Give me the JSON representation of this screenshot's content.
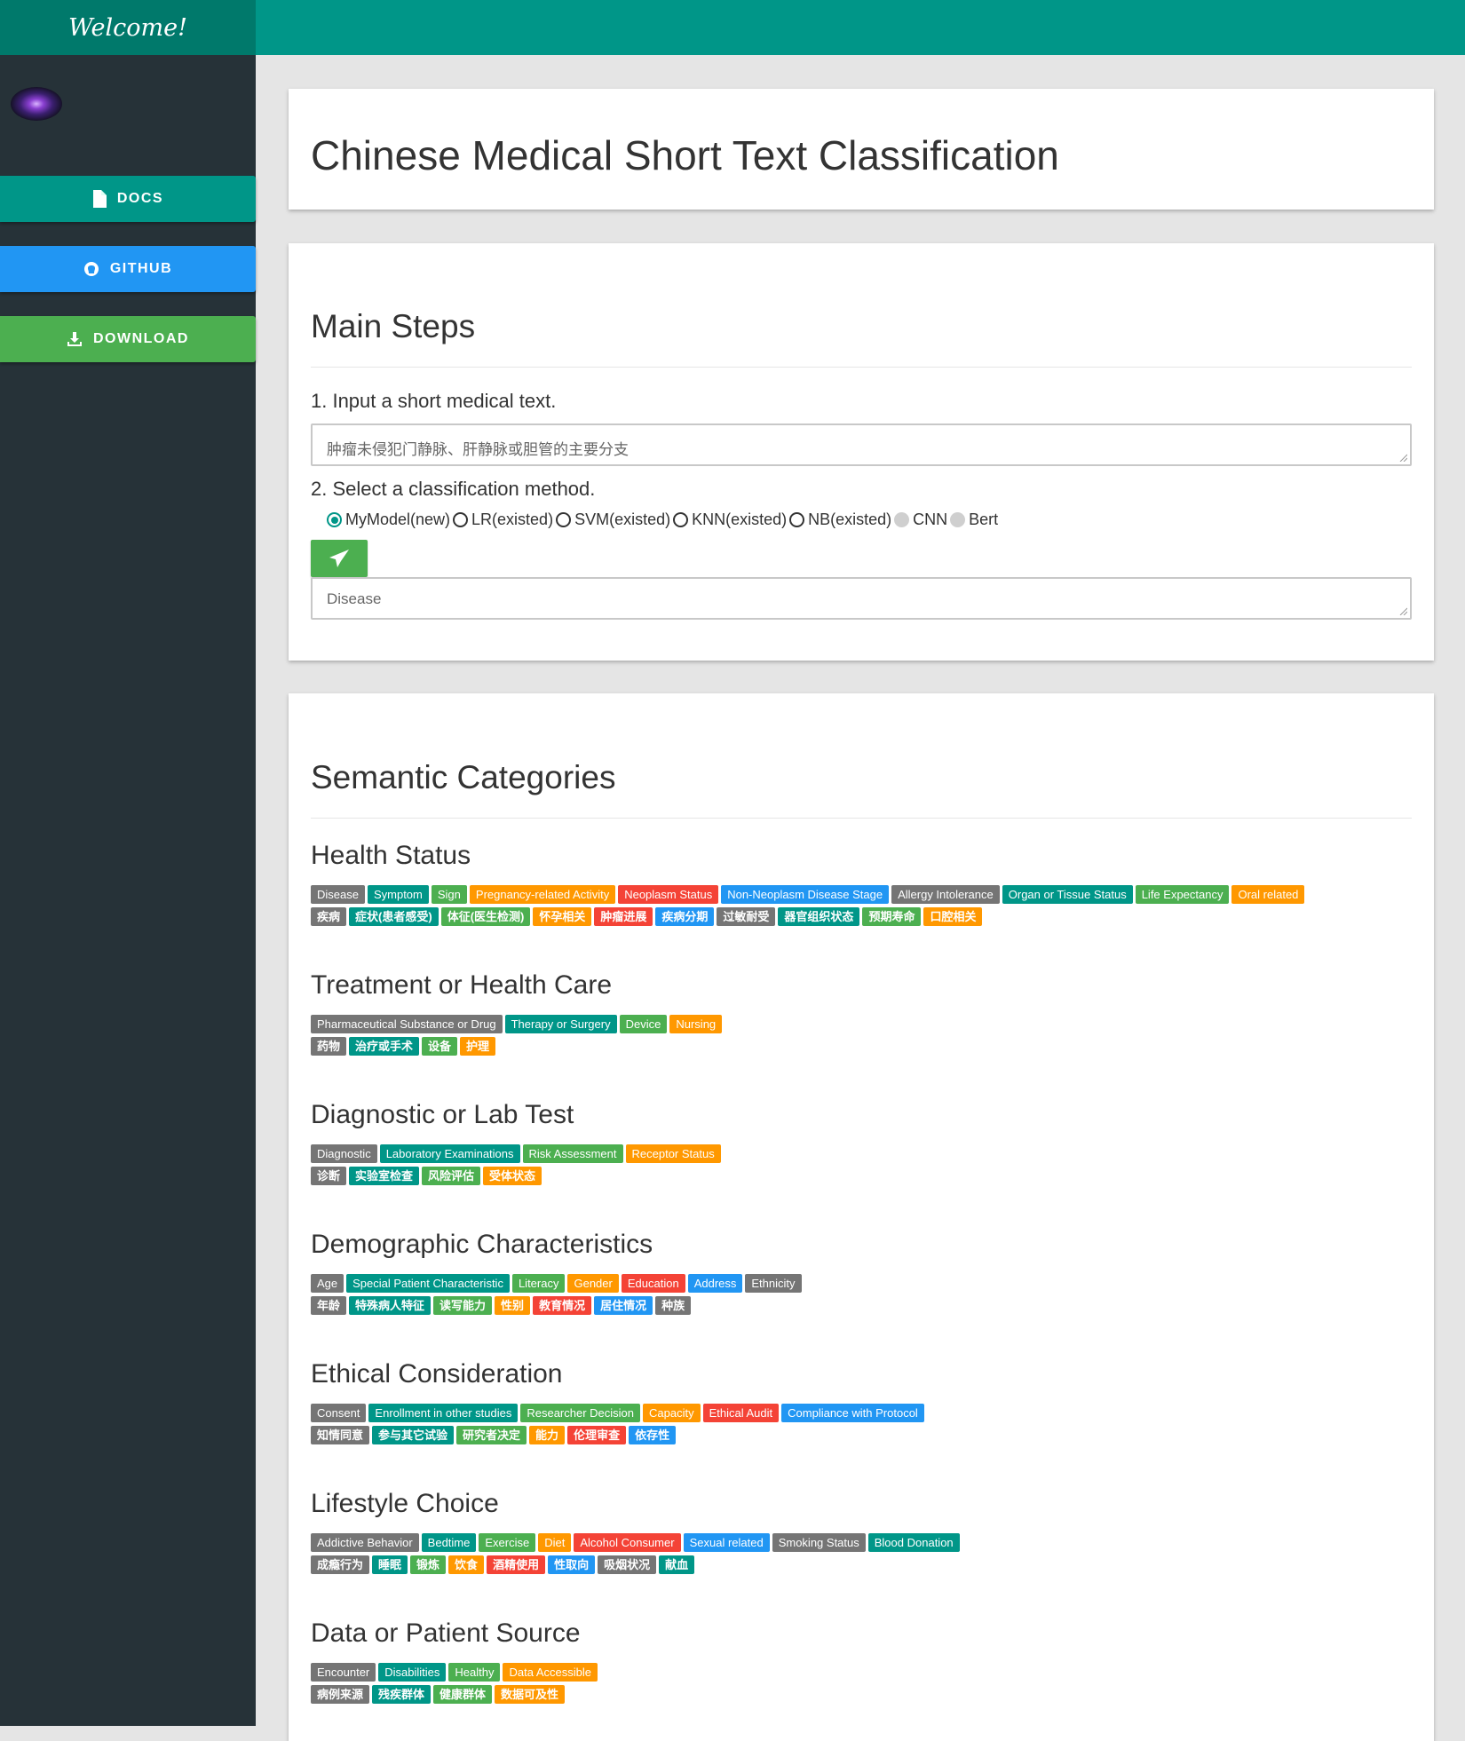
{
  "sidebar": {
    "brand": "Welcome!",
    "nav": {
      "docs": "DOCS",
      "github": "GITHUB",
      "download": "DOWNLOAD"
    }
  },
  "header": {
    "title": "Chinese Medical Short Text Classification"
  },
  "steps": {
    "title": "Main Steps",
    "step1_label": "1. Input a short medical text.",
    "input_value": "肿瘤未侵犯门静脉、肝静脉或胆管的主要分支",
    "step2_label": "2. Select a classification method.",
    "methods": [
      {
        "label": "MyModel(new)",
        "state": "checked"
      },
      {
        "label": "LR(existed)",
        "state": "unchecked"
      },
      {
        "label": "SVM(existed)",
        "state": "unchecked"
      },
      {
        "label": "KNN(existed)",
        "state": "unchecked"
      },
      {
        "label": "NB(existed)",
        "state": "unchecked"
      },
      {
        "label": "CNN",
        "state": "disabled"
      },
      {
        "label": "Bert",
        "state": "disabled"
      }
    ],
    "output_value": "Disease"
  },
  "categories": {
    "title": "Semantic Categories",
    "groups": [
      {
        "title": "Health Status",
        "tags": [
          {
            "en": "Disease",
            "zh": "疾病",
            "color": "grey"
          },
          {
            "en": "Symptom",
            "zh": "症状(患者感受)",
            "color": "teal"
          },
          {
            "en": "Sign",
            "zh": "体征(医生检测)",
            "color": "green"
          },
          {
            "en": "Pregnancy-related Activity",
            "zh": "怀孕相关",
            "color": "orange"
          },
          {
            "en": "Neoplasm Status",
            "zh": "肿瘤进展",
            "color": "red"
          },
          {
            "en": "Non-Neoplasm Disease Stage",
            "zh": "疾病分期",
            "color": "blue"
          },
          {
            "en": "Allergy Intolerance",
            "zh": "过敏耐受",
            "color": "grey"
          },
          {
            "en": "Organ or Tissue Status",
            "zh": "器官组织状态",
            "color": "teal"
          },
          {
            "en": "Life Expectancy",
            "zh": "预期寿命",
            "color": "green"
          },
          {
            "en": "Oral related",
            "zh": "口腔相关",
            "color": "orange"
          }
        ]
      },
      {
        "title": "Treatment or Health Care",
        "tags": [
          {
            "en": "Pharmaceutical Substance or Drug",
            "zh": "药物",
            "color": "grey"
          },
          {
            "en": "Therapy or Surgery",
            "zh": "治疗或手术",
            "color": "teal"
          },
          {
            "en": "Device",
            "zh": "设备",
            "color": "green"
          },
          {
            "en": "Nursing",
            "zh": "护理",
            "color": "orange"
          }
        ]
      },
      {
        "title": "Diagnostic or Lab Test",
        "tags": [
          {
            "en": "Diagnostic",
            "zh": "诊断",
            "color": "grey"
          },
          {
            "en": "Laboratory Examinations",
            "zh": "实验室检查",
            "color": "teal"
          },
          {
            "en": "Risk Assessment",
            "zh": "风险评估",
            "color": "green"
          },
          {
            "en": "Receptor Status",
            "zh": "受体状态",
            "color": "orange"
          }
        ]
      },
      {
        "title": "Demographic Characteristics",
        "tags": [
          {
            "en": "Age",
            "zh": "年龄",
            "color": "grey"
          },
          {
            "en": "Special Patient Characteristic",
            "zh": "特殊病人特征",
            "color": "teal"
          },
          {
            "en": "Literacy",
            "zh": "读写能力",
            "color": "green"
          },
          {
            "en": "Gender",
            "zh": "性别",
            "color": "orange"
          },
          {
            "en": "Education",
            "zh": "教育情况",
            "color": "red"
          },
          {
            "en": "Address",
            "zh": "居住情况",
            "color": "blue"
          },
          {
            "en": "Ethnicity",
            "zh": "种族",
            "color": "grey"
          }
        ]
      },
      {
        "title": "Ethical Consideration",
        "tags": [
          {
            "en": "Consent",
            "zh": "知情同意",
            "color": "grey"
          },
          {
            "en": "Enrollment in other studies",
            "zh": "参与其它试验",
            "color": "teal"
          },
          {
            "en": "Researcher Decision",
            "zh": "研究者决定",
            "color": "green"
          },
          {
            "en": "Capacity",
            "zh": "能力",
            "color": "orange"
          },
          {
            "en": "Ethical Audit",
            "zh": "伦理审查",
            "color": "red"
          },
          {
            "en": "Compliance with Protocol",
            "zh": "依存性",
            "color": "blue"
          }
        ]
      },
      {
        "title": "Lifestyle Choice",
        "tags": [
          {
            "en": "Addictive Behavior",
            "zh": "成瘾行为",
            "color": "grey"
          },
          {
            "en": "Bedtime",
            "zh": "睡眠",
            "color": "teal"
          },
          {
            "en": "Exercise",
            "zh": "锻炼",
            "color": "green"
          },
          {
            "en": "Diet",
            "zh": "饮食",
            "color": "orange"
          },
          {
            "en": "Alcohol Consumer",
            "zh": "酒精使用",
            "color": "red"
          },
          {
            "en": "Sexual related",
            "zh": "性取向",
            "color": "blue"
          },
          {
            "en": "Smoking Status",
            "zh": "吸烟状况",
            "color": "grey"
          },
          {
            "en": "Blood Donation",
            "zh": "献血",
            "color": "teal"
          }
        ]
      },
      {
        "title": "Data or Patient Source",
        "tags": [
          {
            "en": "Encounter",
            "zh": "病例来源",
            "color": "grey"
          },
          {
            "en": "Disabilities",
            "zh": "残疾群体",
            "color": "teal"
          },
          {
            "en": "Healthy",
            "zh": "健康群体",
            "color": "green"
          },
          {
            "en": "Data Accessible",
            "zh": "数据可及性",
            "color": "orange"
          }
        ]
      }
    ]
  }
}
